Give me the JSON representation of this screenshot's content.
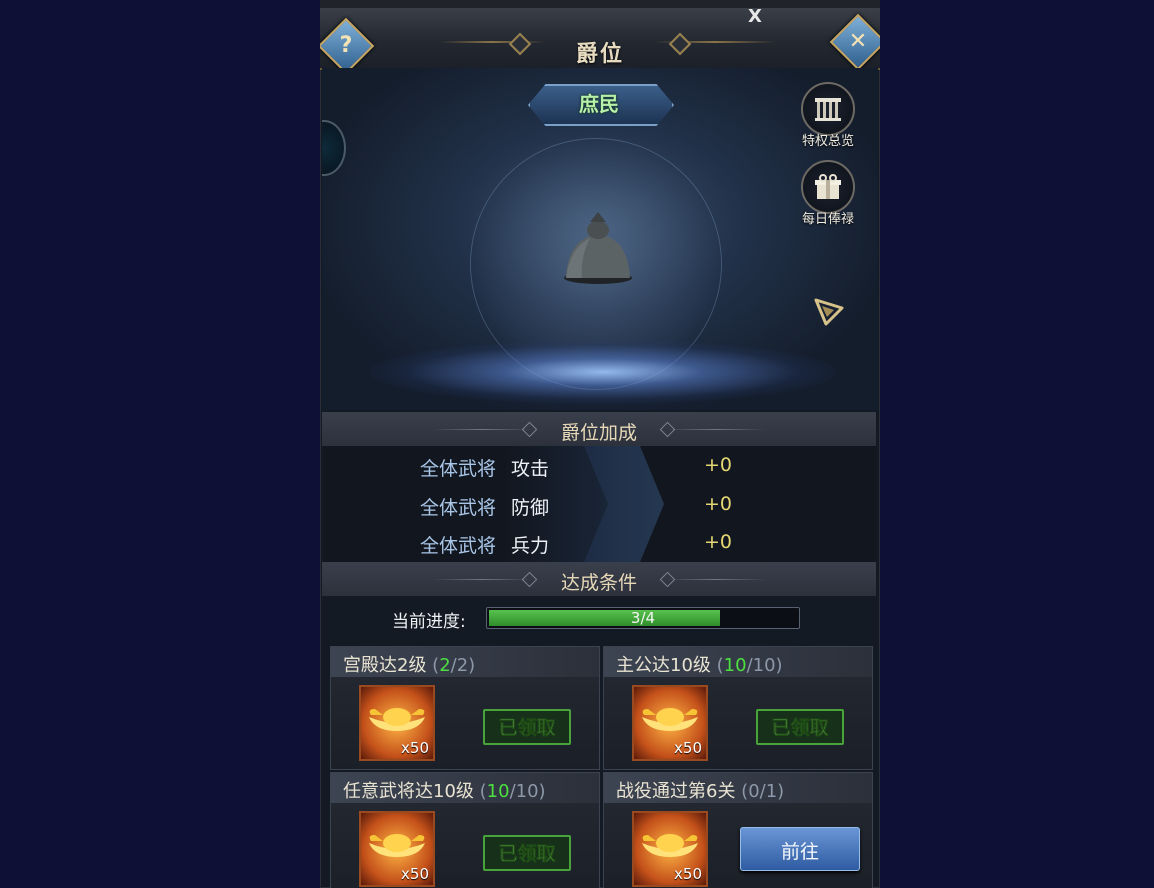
{
  "header": {
    "title": "爵位",
    "help_icon_label": "?",
    "close_icon_label": "✕",
    "tiny_close": "X"
  },
  "hero": {
    "rank_name": "庶民",
    "side_buttons": [
      {
        "label": "特权总览",
        "icon": "scroll-rack-icon"
      },
      {
        "label": "每日俸禄",
        "icon": "gift-box-icon"
      }
    ]
  },
  "bonus": {
    "title": "爵位加成",
    "rows": [
      {
        "target": "全体武将",
        "stat": "攻击",
        "value": "+0"
      },
      {
        "target": "全体武将",
        "stat": "防御",
        "value": "+0"
      },
      {
        "target": "全体武将",
        "stat": "兵力",
        "value": "+0"
      }
    ]
  },
  "conditions": {
    "title": "达成条件",
    "progress_label": "当前进度:",
    "progress_text": "3/4",
    "progress_fraction": 0.75,
    "tasks": [
      {
        "name": "宫殿达2级",
        "open": " (",
        "done": "2",
        "total": "/2)",
        "reward_qty": "x50",
        "status": "已领取"
      },
      {
        "name": "主公达10级",
        "open": " (",
        "done": "10",
        "total": "/10)",
        "reward_qty": "x50",
        "status": "已领取"
      },
      {
        "name": "任意武将达10级",
        "open": " (",
        "done": "10",
        "total": "/10)",
        "reward_qty": "x50",
        "status": "已领取"
      },
      {
        "name": "战役通过第6关",
        "open": " (",
        "done": "0",
        "total": "/1)",
        "reward_qty": "x50",
        "status": "前往"
      }
    ]
  },
  "colors": {
    "done_green": "#4ce040",
    "bonus_value": "#e5d774",
    "rank_green": "#b6f0a9"
  }
}
